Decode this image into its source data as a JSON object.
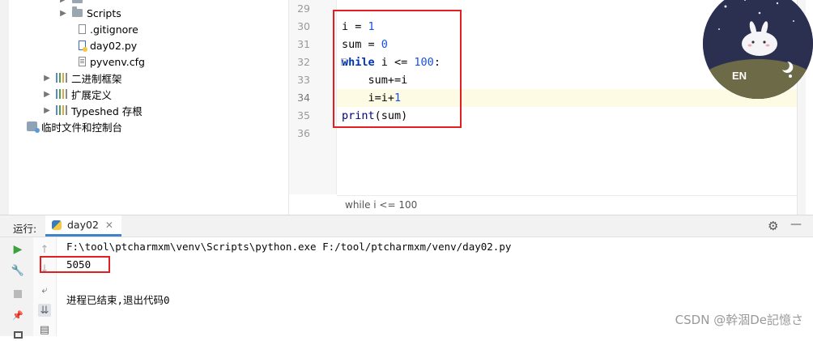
{
  "project_tree": {
    "items": [
      {
        "label": "Scripts",
        "type": "folder"
      },
      {
        "label": ".gitignore",
        "type": "file"
      },
      {
        "label": "day02.py",
        "type": "py"
      },
      {
        "label": "pyvenv.cfg",
        "type": "cfg"
      },
      {
        "label": "二进制框架",
        "type": "lib"
      },
      {
        "label": "扩展定义",
        "type": "lib"
      },
      {
        "label": "Typeshed 存根",
        "type": "lib"
      },
      {
        "label": "临时文件和控制台",
        "type": "scratch"
      }
    ]
  },
  "editor": {
    "line_numbers": [
      "29",
      "30",
      "31",
      "32",
      "33",
      "34",
      "35",
      "36"
    ],
    "breadcrumb": "while i <= 100"
  },
  "run_panel": {
    "label": "运行:",
    "tab_name": "day02",
    "command": "F:\\tool\\ptcharmxm\\venv\\Scripts\\python.exe F:/tool/ptcharmxm/venv/day02.py",
    "result": "5050",
    "exit_message": "进程已结束,退出代码0"
  },
  "avatar": {
    "label": "EN"
  },
  "watermark": "CSDN @幹涸De記憶さ",
  "colors": {
    "highlight_box": "#e02020",
    "keyword": "#0033b3",
    "number": "#1750eb",
    "tab_accent": "#4083c9"
  }
}
